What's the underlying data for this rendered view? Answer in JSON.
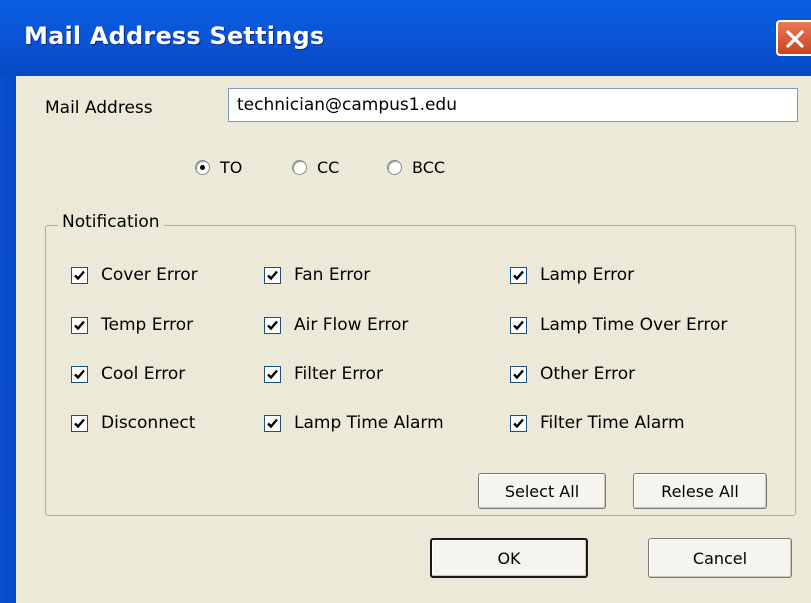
{
  "window": {
    "title": "Mail Address Settings"
  },
  "mail": {
    "label": "Mail Address",
    "value": "technician@campus1.edu"
  },
  "recipient_type": {
    "options": [
      {
        "label": "TO",
        "selected": true
      },
      {
        "label": "CC",
        "selected": false
      },
      {
        "label": "BCC",
        "selected": false
      }
    ]
  },
  "notification": {
    "title": "Notification",
    "items": [
      {
        "label": "Cover Error",
        "checked": true
      },
      {
        "label": "Fan Error",
        "checked": true
      },
      {
        "label": "Lamp Error",
        "checked": true
      },
      {
        "label": "Temp Error",
        "checked": true
      },
      {
        "label": "Air Flow Error",
        "checked": true
      },
      {
        "label": "Lamp Time Over Error",
        "checked": true
      },
      {
        "label": "Cool Error",
        "checked": true
      },
      {
        "label": "Filter Error",
        "checked": true
      },
      {
        "label": "Other Error",
        "checked": true
      },
      {
        "label": "Disconnect",
        "checked": true
      },
      {
        "label": "Lamp Time Alarm",
        "checked": true
      },
      {
        "label": "Filter Time Alarm",
        "checked": true
      }
    ],
    "select_all_label": "Select All",
    "release_all_label": "Relese All"
  },
  "footer": {
    "ok_label": "OK",
    "cancel_label": "Cancel"
  },
  "colors": {
    "titlebar": "#0a55d8",
    "client": "#ece9d8",
    "close": "#d4552f"
  }
}
